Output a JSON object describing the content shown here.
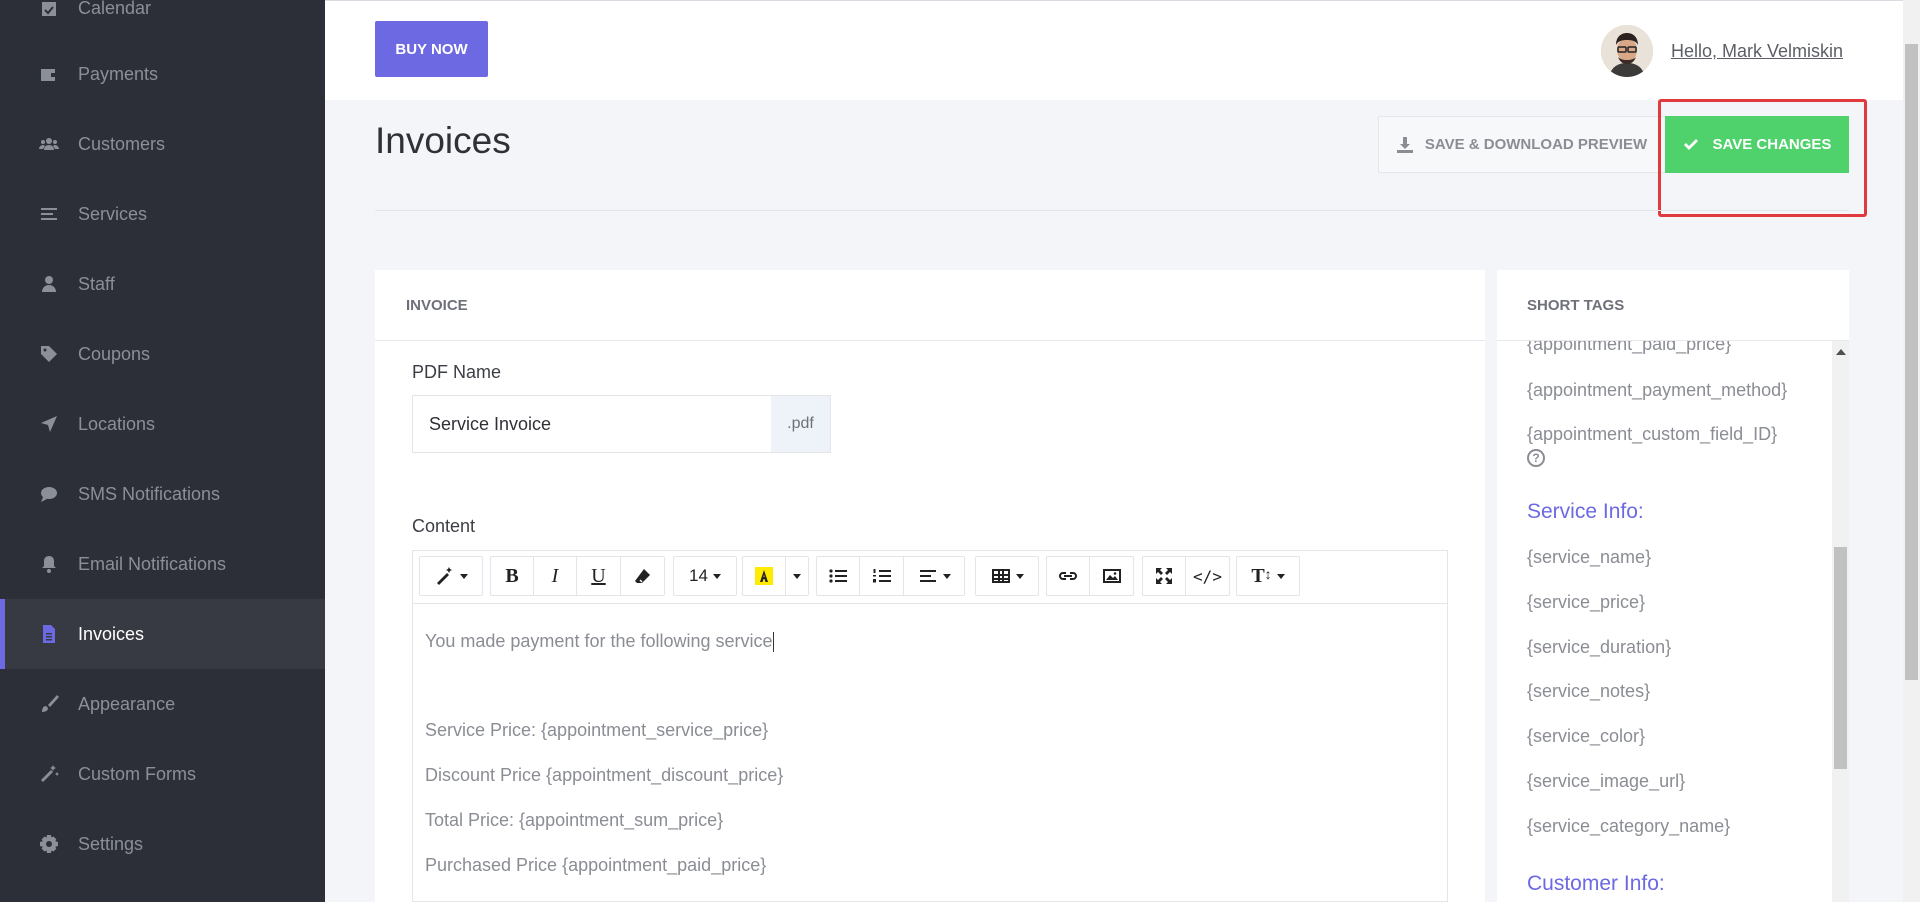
{
  "sidebar": {
    "items": [
      {
        "label": "Calendar",
        "icon": "calendar-check-icon",
        "active": false
      },
      {
        "label": "Payments",
        "icon": "wallet-icon",
        "active": false
      },
      {
        "label": "Customers",
        "icon": "users-icon",
        "active": false
      },
      {
        "label": "Services",
        "icon": "list-icon",
        "active": false
      },
      {
        "label": "Staff",
        "icon": "user-icon",
        "active": false
      },
      {
        "label": "Coupons",
        "icon": "tag-icon",
        "active": false
      },
      {
        "label": "Locations",
        "icon": "location-arrow-icon",
        "active": false
      },
      {
        "label": "SMS Notifications",
        "icon": "chat-bubble-icon",
        "active": false
      },
      {
        "label": "Email Notifications",
        "icon": "bell-icon",
        "active": false
      },
      {
        "label": "Invoices",
        "icon": "file-invoice-icon",
        "active": true
      },
      {
        "label": "Appearance",
        "icon": "paint-brush-icon",
        "active": false
      },
      {
        "label": "Custom Forms",
        "icon": "magic-wand-icon",
        "active": false
      },
      {
        "label": "Settings",
        "icon": "gear-icon",
        "active": false
      }
    ],
    "accent": "#6c69e2"
  },
  "topbar": {
    "buy_now": "BUY NOW",
    "greeting": "Hello, Mark Velmiskin"
  },
  "page": {
    "title": "Invoices",
    "download_button": "SAVE & DOWNLOAD PREVIEW",
    "save_button": "SAVE CHANGES",
    "save_color": "#4fd16b"
  },
  "invoice": {
    "heading": "INVOICE",
    "pdf_name_label": "PDF Name",
    "pdf_name_value": "Service Invoice",
    "pdf_extension": ".pdf",
    "content_label": "Content",
    "font_size": "14",
    "content_lines": [
      "You made payment for the following service",
      "",
      "Service Price: {appointment_service_price}",
      "Discount Price {appointment_discount_price}",
      "Total Price: {appointment_sum_price}",
      "Purchased Price {appointment_paid_price}"
    ]
  },
  "short_tags": {
    "heading": "SHORT TAGS",
    "appointment_tags": [
      "{appointment_paid_price}",
      "{appointment_payment_method}",
      "{appointment_custom_field_ID}"
    ],
    "service_heading": "Service Info:",
    "service_tags": [
      "{service_name}",
      "{service_price}",
      "{service_duration}",
      "{service_notes}",
      "{service_color}",
      "{service_image_url}",
      "{service_category_name}"
    ],
    "customer_heading": "Customer Info:"
  }
}
